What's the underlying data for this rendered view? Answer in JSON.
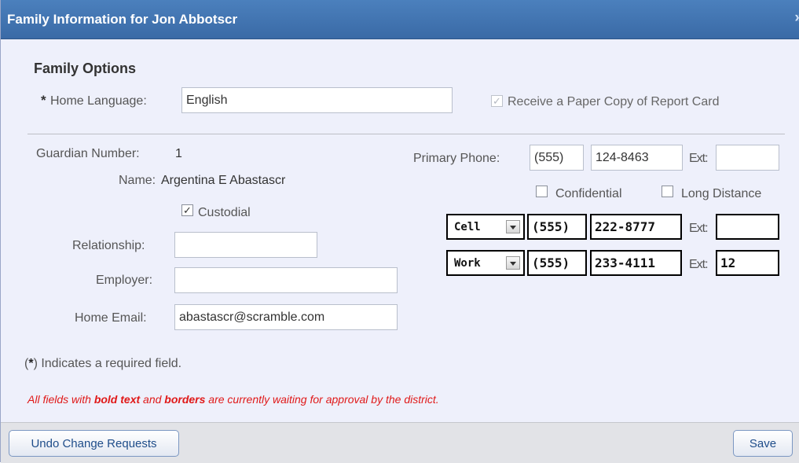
{
  "window": {
    "title": "Family Information for Jon Abbotscr",
    "close_glyph": "»"
  },
  "family_options": {
    "heading": "Family Options",
    "required_mark": "*",
    "home_language_label": "Home Language:",
    "home_language_value": "English",
    "paper_copy_label": "Receive a Paper Copy of Report Card",
    "paper_copy_checked": true
  },
  "guardian": {
    "number_label": "Guardian Number:",
    "number_value": "1",
    "name_label": "Name:",
    "name_value": "Argentina E Abastascr",
    "custodial_label": "Custodial",
    "custodial_checked": true,
    "relationship_label": "Relationship:",
    "relationship_value": "",
    "employer_label": "Employer:",
    "employer_value": "",
    "email_label": "Home Email:",
    "email_value": "abastascr@scramble.com"
  },
  "phones": {
    "primary_label": "Primary Phone:",
    "primary_area": "(555)",
    "primary_number": "124-8463",
    "ext_label": "Ext:",
    "primary_ext": "",
    "confidential_label": "Confidential",
    "long_distance_label": "Long Distance",
    "lines": [
      {
        "type": "Cell",
        "area": "(555)",
        "number": "222-8777",
        "ext": ""
      },
      {
        "type": "Work",
        "area": "(555)",
        "number": "233-4111",
        "ext": "12"
      }
    ]
  },
  "notes": {
    "required_open": "(",
    "required_star": "*",
    "required_text": ") Indicates a required field.",
    "approval_part1": "All fields with ",
    "approval_bold1": "bold text",
    "approval_part2": " and ",
    "approval_bold2": "borders",
    "approval_part3": " are currently waiting for approval by the district."
  },
  "footer": {
    "undo_label": "Undo Change Requests",
    "save_label": "Save"
  },
  "colors": {
    "title_bar": "#3d6fae",
    "dialog_bg": "#eef0fb",
    "pending_note": "#e01818",
    "button_text": "#1f4d8a"
  }
}
